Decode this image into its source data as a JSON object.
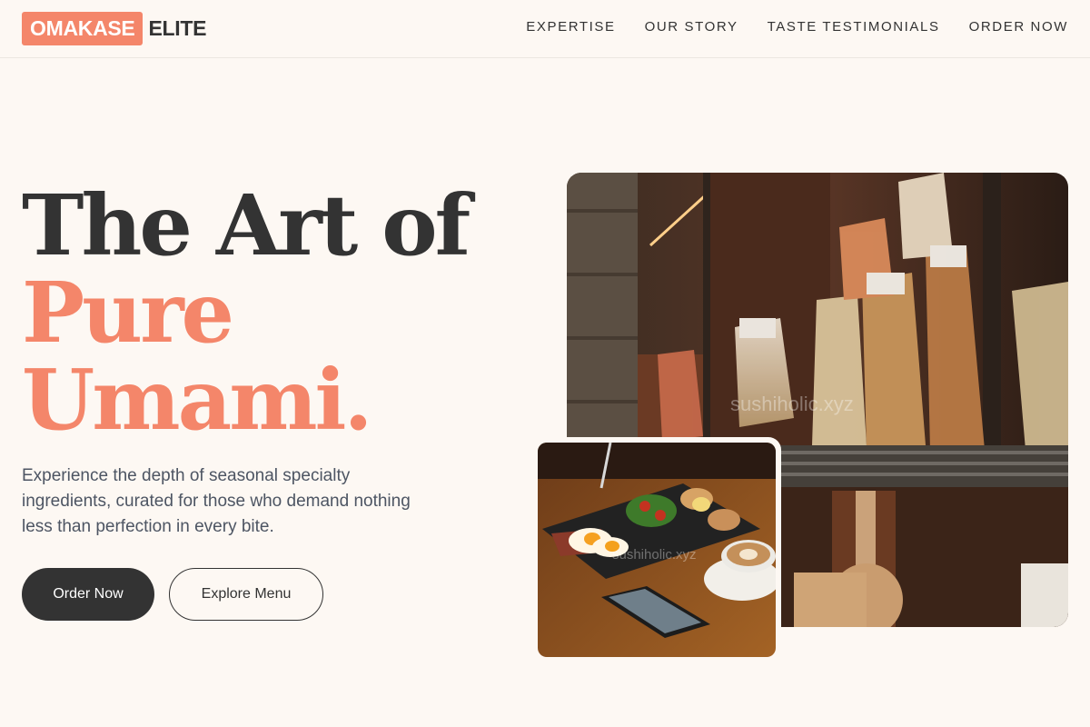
{
  "brand": {
    "logo_box": "OMAKASE",
    "logo_text": "ELITE",
    "accent_color": "#f4866a"
  },
  "nav": {
    "items": [
      {
        "label": "EXPERTISE"
      },
      {
        "label": "OUR STORY"
      },
      {
        "label": "TASTE TESTIMONIALS"
      },
      {
        "label": "ORDER NOW"
      }
    ]
  },
  "hero": {
    "title_line1": "The Art of",
    "title_line2": "Pure",
    "title_line3": "Umami.",
    "subtitle": "Experience the depth of seasonal specialty ingredients, curated for those who demand nothing less than perfection in every bite.",
    "primary_button": "Order Now",
    "secondary_button": "Explore Menu"
  },
  "images": {
    "main_watermark": "sushiholic.xyz",
    "small_watermark": "sushiholic.xyz"
  }
}
